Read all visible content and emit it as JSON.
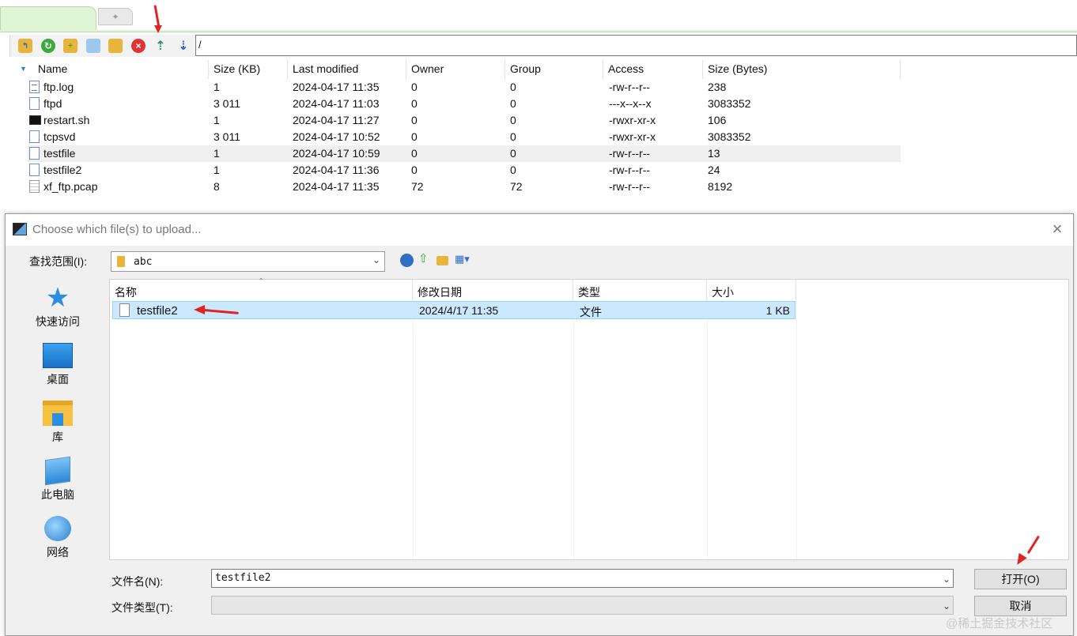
{
  "path": "/",
  "columns": [
    "Name",
    "Size (KB)",
    "Last modified",
    "Owner",
    "Group",
    "Access",
    "Size (Bytes)"
  ],
  "files": [
    {
      "name": "ftp.log",
      "size_kb": "1",
      "modified": "2024-04-17 11:35",
      "owner": "0",
      "group": "0",
      "access": "-rw-r--r--",
      "bytes": "238",
      "icon": "log"
    },
    {
      "name": "ftpd",
      "size_kb": "3 011",
      "modified": "2024-04-17 11:03",
      "owner": "0",
      "group": "0",
      "access": "---x--x--x",
      "bytes": "3083352",
      "icon": "file"
    },
    {
      "name": "restart.sh",
      "size_kb": "1",
      "modified": "2024-04-17 11:27",
      "owner": "0",
      "group": "0",
      "access": "-rwxr-xr-x",
      "bytes": "106",
      "icon": "term"
    },
    {
      "name": "tcpsvd",
      "size_kb": "3 011",
      "modified": "2024-04-17 10:52",
      "owner": "0",
      "group": "0",
      "access": "-rwxr-xr-x",
      "bytes": "3083352",
      "icon": "file"
    },
    {
      "name": "testfile",
      "size_kb": "1",
      "modified": "2024-04-17 10:59",
      "owner": "0",
      "group": "0",
      "access": "-rw-r--r--",
      "bytes": "13",
      "icon": "file"
    },
    {
      "name": "testfile2",
      "size_kb": "1",
      "modified": "2024-04-17 11:36",
      "owner": "0",
      "group": "0",
      "access": "-rw-r--r--",
      "bytes": "24",
      "icon": "file"
    },
    {
      "name": "xf_ftp.pcap",
      "size_kb": "8",
      "modified": "2024-04-17 11:35",
      "owner": "72",
      "group": "72",
      "access": "-rw-r--r--",
      "bytes": "8192",
      "icon": "pcap"
    }
  ],
  "dialog": {
    "title": "Choose which file(s) to upload...",
    "lookin_label": "查找范围(I):",
    "lookin_value": "abc",
    "places": [
      "快速访问",
      "桌面",
      "库",
      "此电脑",
      "网络"
    ],
    "columns": [
      "名称",
      "修改日期",
      "类型",
      "大小"
    ],
    "file": {
      "name": "testfile2",
      "date": "2024/4/17 11:35",
      "type": "文件",
      "size": "1 KB"
    },
    "filename_label": "文件名(N):",
    "filename_value": "testfile2",
    "filetype_label": "文件类型(T):",
    "open_label": "打开(O)",
    "cancel_label": "取消"
  },
  "watermark": "@稀土掘金技术社区",
  "colors": {
    "accent_green": "#dff5d6",
    "selection": "#cce8ff",
    "annotation": "#e02424"
  }
}
